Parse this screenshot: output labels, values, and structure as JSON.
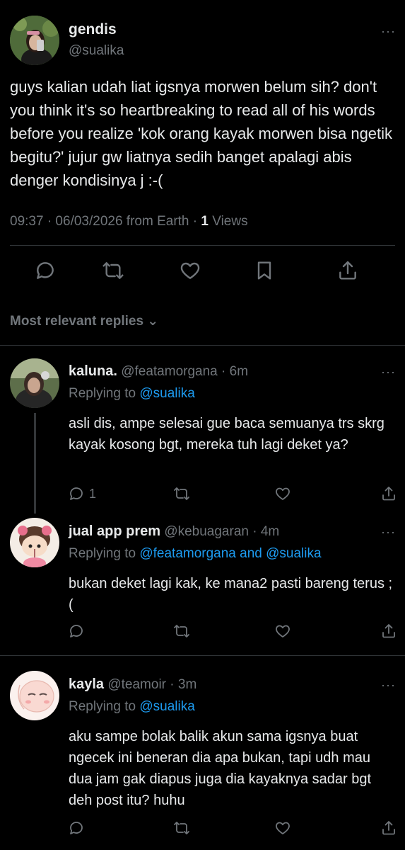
{
  "main": {
    "name": "gendis",
    "handle": "@sualika",
    "text": "guys kalian udah liat igsnya morwen belum sih? don't you think it's so heartbreaking to read all of his words before you realize 'kok orang kayak morwen bisa ngetik begitu?' jujur gw liatnya sedih banget apalagi abis denger kondisinya j :-(",
    "meta_prefix": "09:37 · 06/03/2026 from Earth · ",
    "views_count": "1",
    "views_label": " Views",
    "more": "···"
  },
  "sort_label": "Most relevant replies ⌄",
  "replies": [
    {
      "name": "kaluna.",
      "handle": "@featamorgana · 6m",
      "replying_prefix": "Replying to ",
      "replying_to": "@sualika",
      "text": "asli dis, ampe selesai gue baca semuanya trs skrg kayak kosong bgt, mereka tuh lagi deket ya?",
      "reply_count": "1",
      "more": "···"
    },
    {
      "name": "jual app prem",
      "handle": "@kebuagaran · 4m",
      "replying_prefix": "Replying to ",
      "replying_to": "@featamorgana and @sualika",
      "text": "bukan deket lagi kak, ke mana2 pasti bareng terus ;(",
      "reply_count": "",
      "more": "···"
    },
    {
      "name": "kayla",
      "handle": "@teamoir · 3m",
      "replying_prefix": "Replying to ",
      "replying_to": "@sualika",
      "text": "aku sampe bolak balik akun sama igsnya buat ngecek ini beneran dia apa bukan, tapi udh mau dua jam gak diapus juga dia kayaknya sadar bgt deh post itu? huhu",
      "reply_count": "",
      "more": "···"
    }
  ],
  "icons": {
    "reply": "reply-icon",
    "retweet": "retweet-icon",
    "like": "like-icon",
    "bookmark": "bookmark-icon",
    "share": "share-icon",
    "more": "more-icon"
  },
  "colors": {
    "background": "#000000",
    "text": "#e7e9ea",
    "secondary": "#71767b",
    "link": "#1d9bf0",
    "divider": "#2f3336"
  }
}
